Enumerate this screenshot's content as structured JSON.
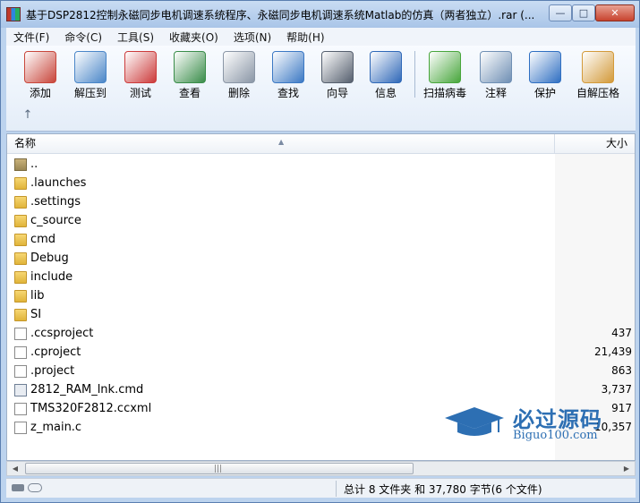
{
  "window": {
    "title": "基于DSP2812控制永磁同步电机调速系统程序、永磁同步电机调速系统Matlab的仿真（两者独立）.rar (...",
    "min_label": "—",
    "max_label": "□",
    "close_label": "✕"
  },
  "menu": [
    "文件(F)",
    "命令(C)",
    "工具(S)",
    "收藏夹(O)",
    "选项(N)",
    "帮助(H)"
  ],
  "toolbar": {
    "buttons": [
      {
        "label": "添加",
        "icon": "books-add-icon",
        "color": "#c8463b"
      },
      {
        "label": "解压到",
        "icon": "folder-extract-icon",
        "color": "#4a86c8"
      },
      {
        "label": "测试",
        "icon": "checklist-icon",
        "color": "#cc3b3b"
      },
      {
        "label": "查看",
        "icon": "open-book-icon",
        "color": "#3a8d4a"
      },
      {
        "label": "删除",
        "icon": "trash-can-icon",
        "color": "#8a96a6"
      },
      {
        "label": "查找",
        "icon": "magnifier-icon",
        "color": "#3b78c4"
      },
      {
        "label": "向导",
        "icon": "magic-wand-icon",
        "color": "#555f6e"
      },
      {
        "label": "信息",
        "icon": "info-icon",
        "color": "#2f68b8"
      },
      {
        "label": "扫描病毒",
        "icon": "virus-scan-icon",
        "color": "#48a63c"
      },
      {
        "label": "注释",
        "icon": "comment-icon",
        "color": "#6f8fb4"
      },
      {
        "label": "保护",
        "icon": "shield-icon",
        "color": "#2f6fc2"
      },
      {
        "label": "自解压格",
        "icon": "sfx-box-icon",
        "color": "#d39a3a"
      }
    ],
    "up_label": "↑"
  },
  "list": {
    "col_name": "名称",
    "col_size": "大小",
    "sort_indicator": "▲",
    "rows": [
      {
        "name": "..",
        "size": "",
        "type": "parent"
      },
      {
        "name": ".launches",
        "size": "",
        "type": "folder"
      },
      {
        "name": ".settings",
        "size": "",
        "type": "folder"
      },
      {
        "name": "c_source",
        "size": "",
        "type": "folder"
      },
      {
        "name": "cmd",
        "size": "",
        "type": "folder"
      },
      {
        "name": "Debug",
        "size": "",
        "type": "folder"
      },
      {
        "name": "include",
        "size": "",
        "type": "folder"
      },
      {
        "name": "lib",
        "size": "",
        "type": "folder"
      },
      {
        "name": "SI",
        "size": "",
        "type": "folder"
      },
      {
        "name": ".ccsproject",
        "size": "437",
        "type": "file"
      },
      {
        "name": ".cproject",
        "size": "21,439",
        "type": "file"
      },
      {
        "name": ".project",
        "size": "863",
        "type": "file"
      },
      {
        "name": "2812_RAM_lnk.cmd",
        "size": "3,737",
        "type": "cmd"
      },
      {
        "name": "TMS320F2812.ccxml",
        "size": "917",
        "type": "file"
      },
      {
        "name": "z_main.c",
        "size": "10,357",
        "type": "file"
      }
    ]
  },
  "watermark": {
    "big": "必过源码",
    "small": "Biguo100.com"
  },
  "scrollbar": {
    "left": "◀",
    "right": "▶",
    "grip": "|||"
  },
  "status": {
    "text": "总计 8 文件夹 和 37,780 字节(6 个文件)"
  }
}
